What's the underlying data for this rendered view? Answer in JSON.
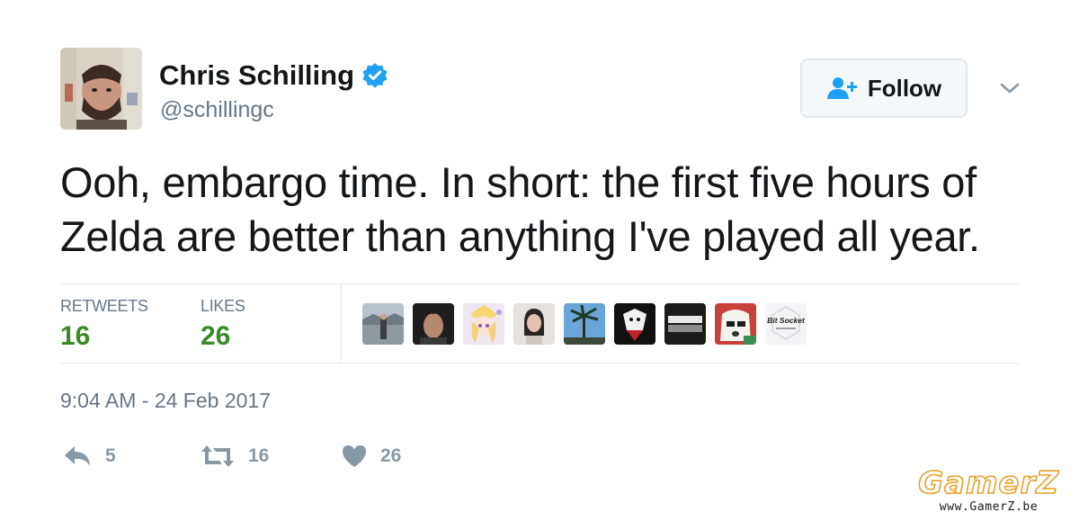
{
  "author": {
    "name": "Chris Schilling",
    "handle": "@schillingc",
    "verified": true
  },
  "follow_button": {
    "label": "Follow",
    "icon": "follow-person-plus-icon"
  },
  "menu_icon": "chevron-down-icon",
  "tweet": {
    "text": "Ooh, embargo time. In short: the first five hours of Zelda are better than anything I've played all year."
  },
  "stats": {
    "retweets_label": "RETWEETS",
    "retweets_count": "16",
    "likes_label": "LIKES",
    "likes_count": "26"
  },
  "likers": [
    {
      "icon": "avatar-lake-person"
    },
    {
      "icon": "avatar-dark-hair-man"
    },
    {
      "icon": "avatar-anime-girl"
    },
    {
      "icon": "avatar-woman-portrait"
    },
    {
      "icon": "avatar-palm-tree"
    },
    {
      "icon": "avatar-dark-character"
    },
    {
      "icon": "avatar-gray-stripes"
    },
    {
      "icon": "avatar-cartoon-dog"
    },
    {
      "icon": "avatar-bit-socket",
      "logo_text": "Bit Socket"
    }
  ],
  "timestamp": "9:04 AM - 24 Feb 2017",
  "actions": {
    "reply_count": "5",
    "retweet_count": "16",
    "like_count": "26"
  },
  "watermark": {
    "logo": "GamerZ",
    "url": "www.GamerZ.be"
  },
  "colors": {
    "stat_value": "#3b8a2a",
    "secondary_text": "#657786",
    "action_gray": "#8899a6",
    "verified_blue": "#1da1f2",
    "follow_icon_blue": "#1da1f2",
    "watermark_orange": "#e8a12a"
  }
}
